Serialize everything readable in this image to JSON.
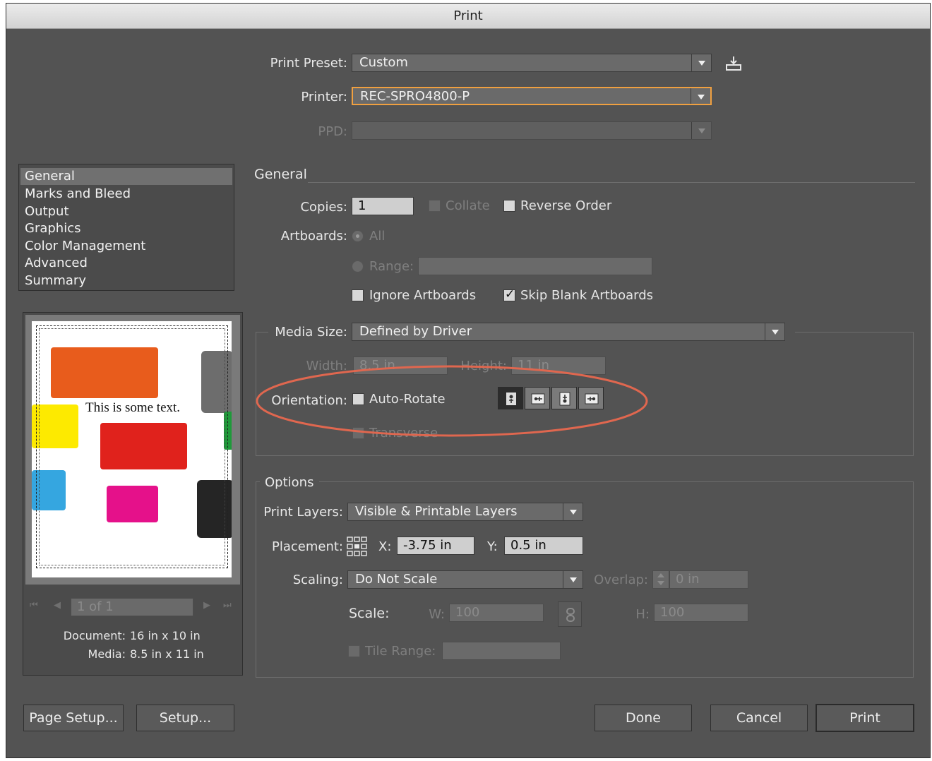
{
  "window": {
    "title": "Print"
  },
  "preset": {
    "label": "Print Preset:",
    "value": "Custom",
    "save_icon": "save-preset-icon"
  },
  "printer": {
    "label": "Printer:",
    "value": "REC-SPRO4800-P"
  },
  "ppd": {
    "label": "PPD:",
    "value": ""
  },
  "sidebar": {
    "items": [
      {
        "label": "General",
        "selected": true
      },
      {
        "label": "Marks and Bleed"
      },
      {
        "label": "Output"
      },
      {
        "label": "Graphics"
      },
      {
        "label": "Color Management"
      },
      {
        "label": "Advanced"
      },
      {
        "label": "Summary"
      }
    ]
  },
  "preview": {
    "text": "This is some text.",
    "page_indicator": "1 of 1",
    "document_label": "Document:",
    "document_value": "16 in x 10 in",
    "media_label": "Media:",
    "media_value": "8.5 in x 11 in",
    "colors": {
      "orange": "#e85c1c",
      "gray": "#6d6d6d",
      "yellow": "#fdea00",
      "red": "#e0221c",
      "green": "#1f9a3a",
      "blue": "#35a6e0",
      "magenta": "#e5118a",
      "black": "#252525"
    }
  },
  "general": {
    "section_title": "General",
    "copies_label": "Copies:",
    "copies_value": "1",
    "collate_label": "Collate",
    "reverse_label": "Reverse Order",
    "artboards_label": "Artboards:",
    "all_label": "All",
    "range_label": "Range:",
    "range_value": "",
    "ignore_label": "Ignore Artboards",
    "skip_label": "Skip Blank Artboards",
    "skip_checked": true
  },
  "media": {
    "label": "Media Size:",
    "value": "Defined by Driver",
    "width_label": "Width:",
    "width_value": "8.5 in",
    "height_label": "Height:",
    "height_value": "11 in",
    "orientation_label": "Orientation:",
    "autorotate_label": "Auto-Rotate",
    "transverse_label": "Transverse",
    "annotation_color": "#e0674f"
  },
  "options": {
    "section_title": "Options",
    "layers_label": "Print Layers:",
    "layers_value": "Visible & Printable Layers",
    "placement_label": "Placement:",
    "x_label": "X:",
    "x_value": "-3.75 in",
    "y_label": "Y:",
    "y_value": "0.5 in",
    "scaling_label": "Scaling:",
    "scaling_value": "Do Not Scale",
    "overlap_label": "Overlap:",
    "overlap_value": "0 in",
    "scale_label": "Scale:",
    "w_label": "W:",
    "w_value": "100",
    "h_label": "H:",
    "h_value": "100",
    "tile_label": "Tile Range:",
    "tile_value": ""
  },
  "buttons": {
    "page_setup": "Page Setup...",
    "setup": "Setup...",
    "done": "Done",
    "cancel": "Cancel",
    "print": "Print"
  }
}
